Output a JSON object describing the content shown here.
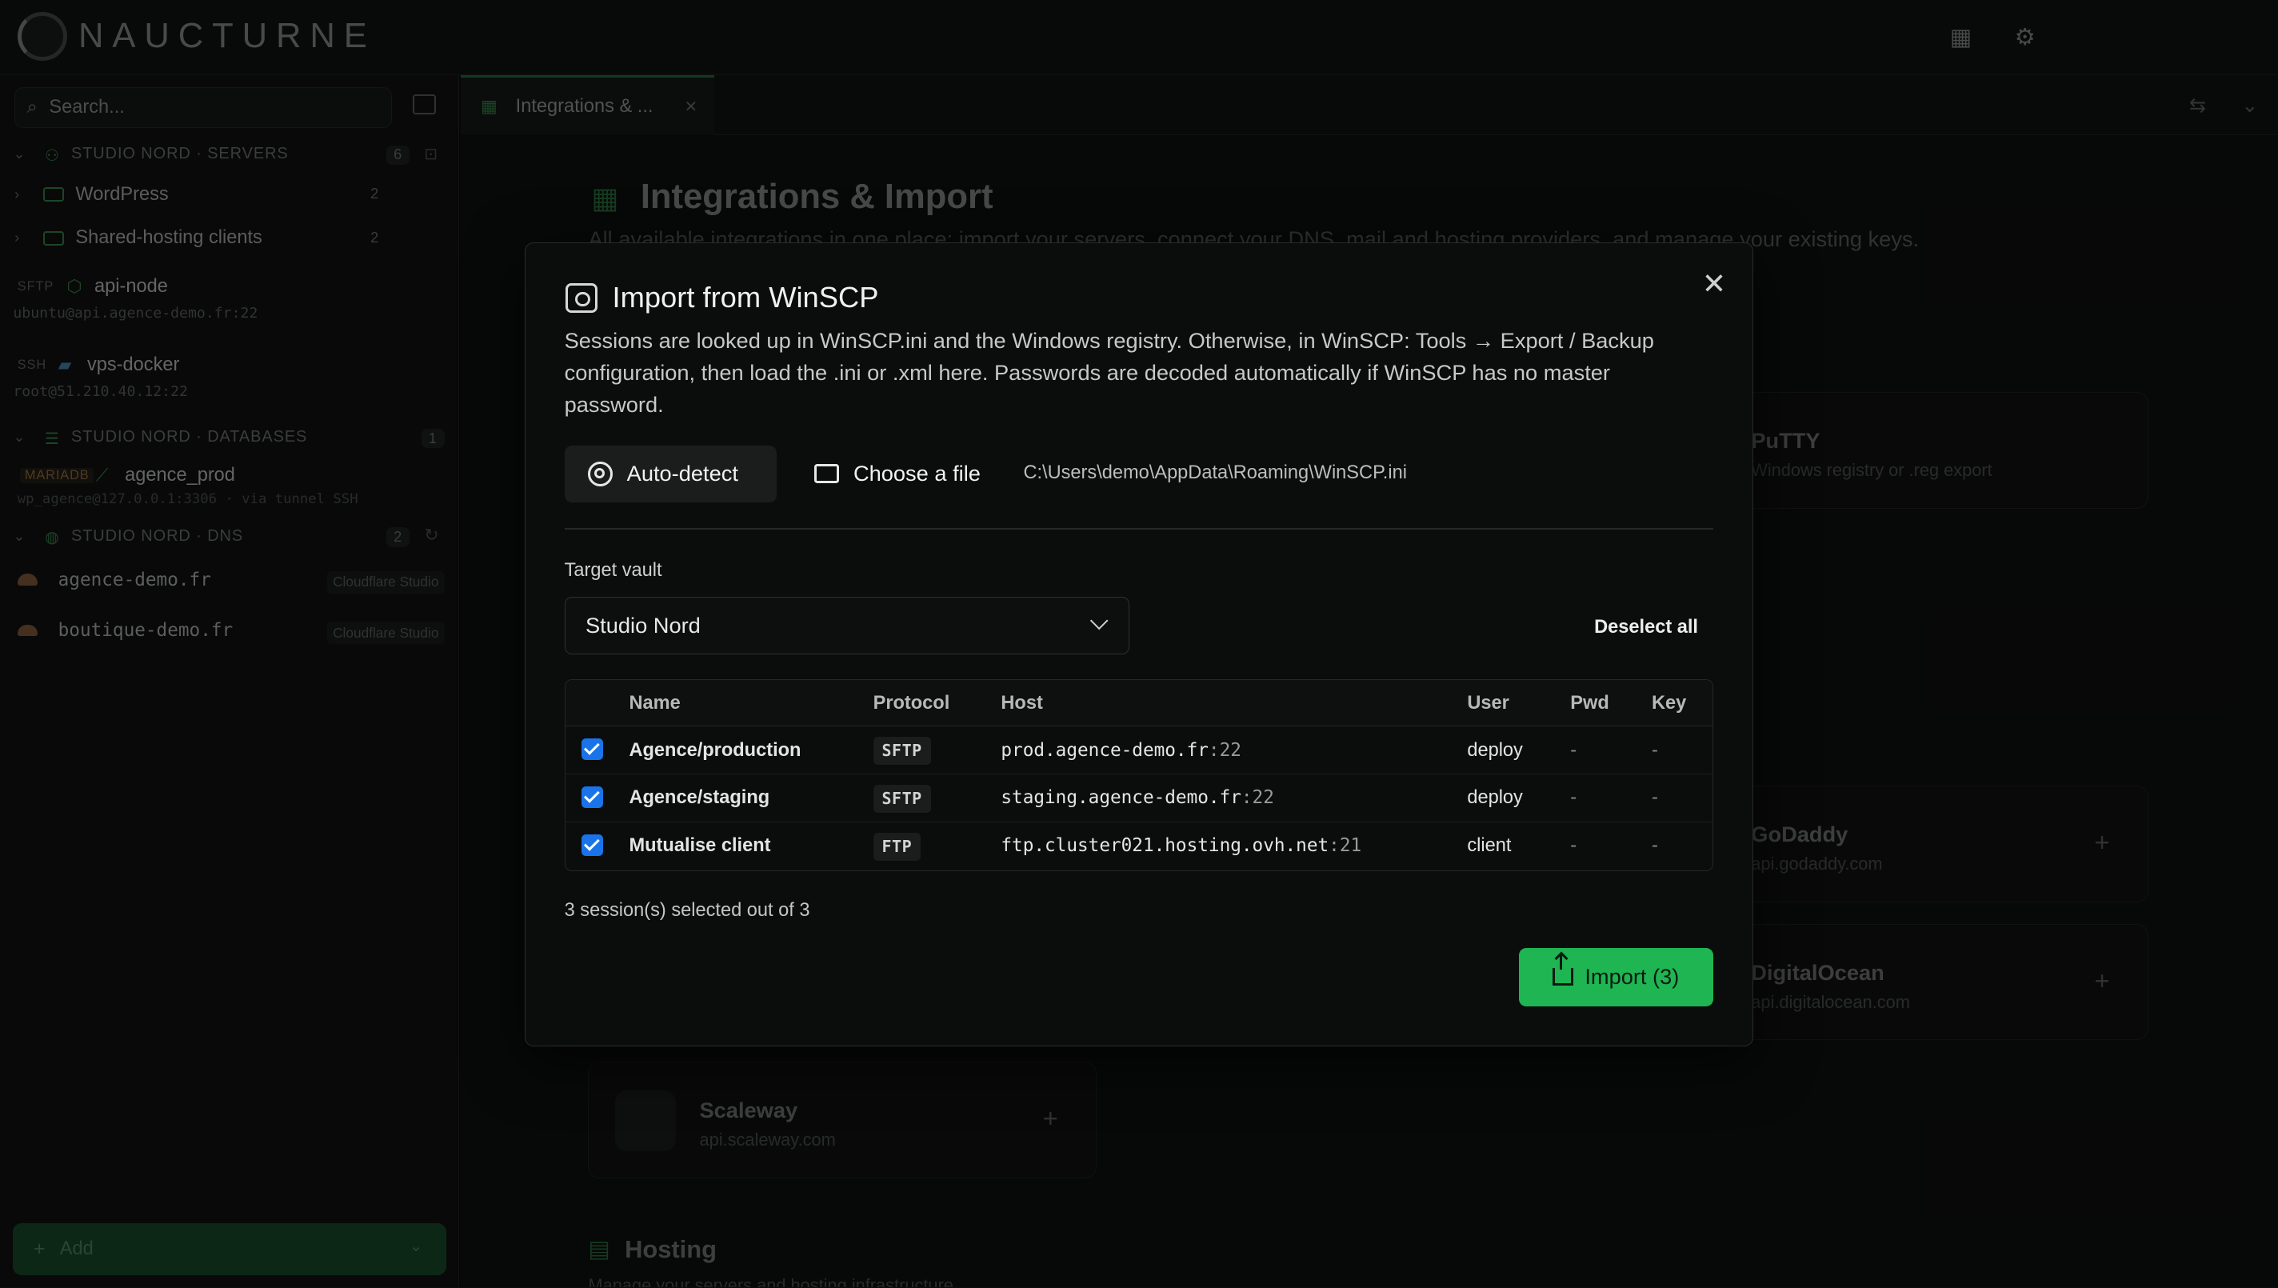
{
  "app": {
    "logo_text": "NAUCTURNE"
  },
  "sidebar": {
    "search_placeholder": "Search...",
    "servers_header": {
      "label": "STUDIO NORD · SERVERS",
      "count": "6"
    },
    "folders": [
      {
        "label": "WordPress",
        "count": "2"
      },
      {
        "label": "Shared-hosting clients",
        "count": "2"
      }
    ],
    "connections": [
      {
        "tag": "SFTP",
        "name": "api-node",
        "sub": "ubuntu@api.agence-demo.fr:22"
      },
      {
        "tag": "SSH",
        "name": "vps-docker",
        "sub": "root@51.210.40.12:22"
      }
    ],
    "databases_header": {
      "label": "STUDIO NORD · DATABASES",
      "count": "1"
    },
    "database": {
      "tag": "MARIADB",
      "name": "agence_prod",
      "sub": "wp_agence@127.0.0.1:3306 · via tunnel SSH"
    },
    "dns_header": {
      "label": "STUDIO NORD · DNS",
      "count": "2"
    },
    "dns_items": [
      {
        "name": "agence-demo.fr",
        "provider": "Cloudflare Studio"
      },
      {
        "name": "boutique-demo.fr",
        "provider": "Cloudflare Studio"
      }
    ],
    "add_label": "Add"
  },
  "tab": {
    "label": "Integrations & ..."
  },
  "main": {
    "title": "Integrations & Import",
    "subtitle": "All available integrations in one place: import your servers, connect your DNS, mail and hosting providers, and manage your existing keys.",
    "cards": [
      {
        "name": "PuTTY",
        "sub": "Windows registry or .reg export"
      },
      {
        "name": "GoDaddy",
        "sub": "api.godaddy.com"
      },
      {
        "name": "DigitalOcean",
        "sub": "api.digitalocean.com"
      },
      {
        "name": "Scaleway",
        "sub": "api.scaleway.com"
      }
    ],
    "hosting_title": "Hosting",
    "hosting_sub": "Manage your servers and hosting infrastructure"
  },
  "modal": {
    "title": "Import from WinSCP",
    "description": "Sessions are looked up in WinSCP.ini and the Windows registry. Otherwise, in WinSCP: Tools → Export / Backup configuration, then load the .ini or .xml here. Passwords are decoded automatically if WinSCP has no master password.",
    "auto_detect_label": "Auto-detect",
    "choose_file_label": "Choose a file",
    "file_path": "C:\\Users\\demo\\AppData\\Roaming\\WinSCP.ini",
    "target_vault_label": "Target vault",
    "target_vault_value": "Studio Nord",
    "deselect_all_label": "Deselect all",
    "columns": [
      "Name",
      "Protocol",
      "Host",
      "User",
      "Pwd",
      "Key"
    ],
    "rows": [
      {
        "checked": true,
        "name": "Agence/production",
        "protocol": "SFTP",
        "host": "prod.agence-demo.fr",
        "port": ":22",
        "user": "deploy",
        "pwd": "-",
        "key": "-"
      },
      {
        "checked": true,
        "name": "Agence/staging",
        "protocol": "SFTP",
        "host": "staging.agence-demo.fr",
        "port": ":22",
        "user": "deploy",
        "pwd": "-",
        "key": "-"
      },
      {
        "checked": true,
        "name": "Mutualise client",
        "protocol": "FTP",
        "host": "ftp.cluster021.hosting.ovh.net",
        "port": ":21",
        "user": "client",
        "pwd": "-",
        "key": "-"
      }
    ],
    "selected_count_text": "3 session(s) selected out of 3",
    "import_label": "Import (3)"
  },
  "colors": {
    "accent": "#1fb552",
    "checkbox": "#1a73e8",
    "background": "#0b0c0c"
  }
}
